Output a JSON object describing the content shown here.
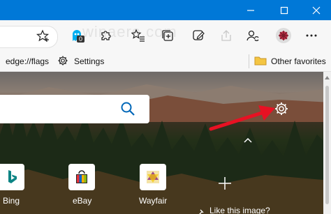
{
  "window": {
    "buttons": [
      "minimize",
      "maximize",
      "close"
    ]
  },
  "toolbar": {
    "extension_badge_count": "0",
    "watermark": "winaero.com"
  },
  "favorites_bar": {
    "items": [
      {
        "label": "edge://flags",
        "icon": "none"
      },
      {
        "label": "Settings",
        "icon": "gear-icon"
      }
    ],
    "other_favorites_label": "Other favorites"
  },
  "new_tab_page": {
    "tiles": [
      {
        "label": "Bing",
        "icon": "bing-icon"
      },
      {
        "label": "eBay",
        "icon": "ebay-icon"
      },
      {
        "label": "Wayfair",
        "icon": "wayfair-icon"
      }
    ],
    "image_caption": "Like this image?",
    "annotation_arrow_color": "#e81123"
  },
  "colors": {
    "titlebar": "#0078d7"
  }
}
